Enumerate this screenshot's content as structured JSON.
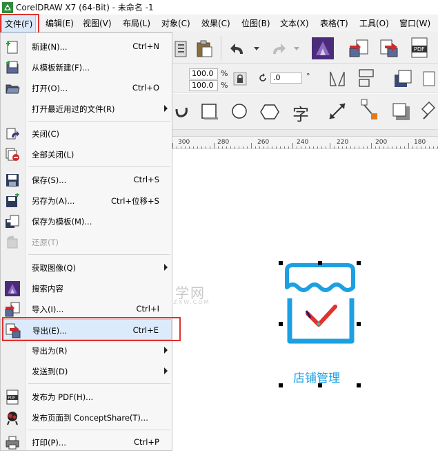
{
  "window": {
    "title": "CorelDRAW X7 (64-Bit) - 未命名 -1"
  },
  "menubar": {
    "items": [
      {
        "label": "文件(F)"
      },
      {
        "label": "编辑(E)"
      },
      {
        "label": "视图(V)"
      },
      {
        "label": "布局(L)"
      },
      {
        "label": "对象(C)"
      },
      {
        "label": "效果(C)"
      },
      {
        "label": "位图(B)"
      },
      {
        "label": "文本(X)"
      },
      {
        "label": "表格(T)"
      },
      {
        "label": "工具(O)"
      },
      {
        "label": "窗口(W)"
      }
    ]
  },
  "file_menu": {
    "items": [
      {
        "label": "新建(N)...",
        "shortcut": "Ctrl+N",
        "icon": "new-document-icon"
      },
      {
        "label": "从模板新建(F)...",
        "shortcut": "",
        "icon": "new-from-template-icon"
      },
      {
        "label": "打开(O)...",
        "shortcut": "Ctrl+O",
        "icon": "open-folder-icon"
      },
      {
        "label": "打开最近用过的文件(R)",
        "shortcut": "",
        "icon": "",
        "submenu": true
      },
      {
        "label": "关闭(C)",
        "shortcut": "",
        "icon": "close-document-icon"
      },
      {
        "label": "全部关闭(L)",
        "shortcut": "",
        "icon": "close-all-icon"
      },
      {
        "label": "保存(S)...",
        "shortcut": "Ctrl+S",
        "icon": "save-icon"
      },
      {
        "label": "另存为(A)...",
        "shortcut": "Ctrl+位移+S",
        "icon": "save-as-icon"
      },
      {
        "label": "保存为模板(M)...",
        "shortcut": "",
        "icon": "save-as-template-icon"
      },
      {
        "label": "还原(T)",
        "shortcut": "",
        "icon": "revert-icon",
        "disabled": true
      },
      {
        "label": "获取图像(Q)",
        "shortcut": "",
        "icon": "",
        "submenu": true
      },
      {
        "label": "搜索内容",
        "shortcut": "",
        "icon": "search-content-icon"
      },
      {
        "label": "导入(I)...",
        "shortcut": "Ctrl+I",
        "icon": "import-icon"
      },
      {
        "label": "导出(E)...",
        "shortcut": "Ctrl+E",
        "icon": "export-icon",
        "highlighted": true
      },
      {
        "label": "导出为(R)",
        "shortcut": "",
        "icon": "",
        "submenu": true
      },
      {
        "label": "发送到(D)",
        "shortcut": "",
        "icon": "",
        "submenu": true
      },
      {
        "label": "发布为 PDF(H)...",
        "shortcut": "",
        "icon": "pdf-icon"
      },
      {
        "label": "发布页面到 ConceptShare(T)...",
        "shortcut": "",
        "icon": "conceptshare-icon"
      },
      {
        "label": "打印(P)...",
        "shortcut": "Ctrl+P",
        "icon": "print-icon"
      }
    ]
  },
  "toolbar": {
    "width_value": "100.0",
    "height_value": "100.0",
    "percent_symbol": "%",
    "rotation_value": ".0",
    "degree_symbol": "°",
    "text_tool_glyph": "字"
  },
  "ruler": {
    "labels": [
      "300",
      "280",
      "260",
      "240",
      "220",
      "200",
      "180"
    ]
  },
  "canvas": {
    "watermark": "软件自学网",
    "watermark_sub": "WWW.RJZXW.COM",
    "logo_text": "店铺管理",
    "logo_color": "#1ca0e3",
    "check_color": "#e0322e"
  },
  "colors": {
    "highlight_box": "#e0322e",
    "menu_highlight": "#dcebfb"
  }
}
